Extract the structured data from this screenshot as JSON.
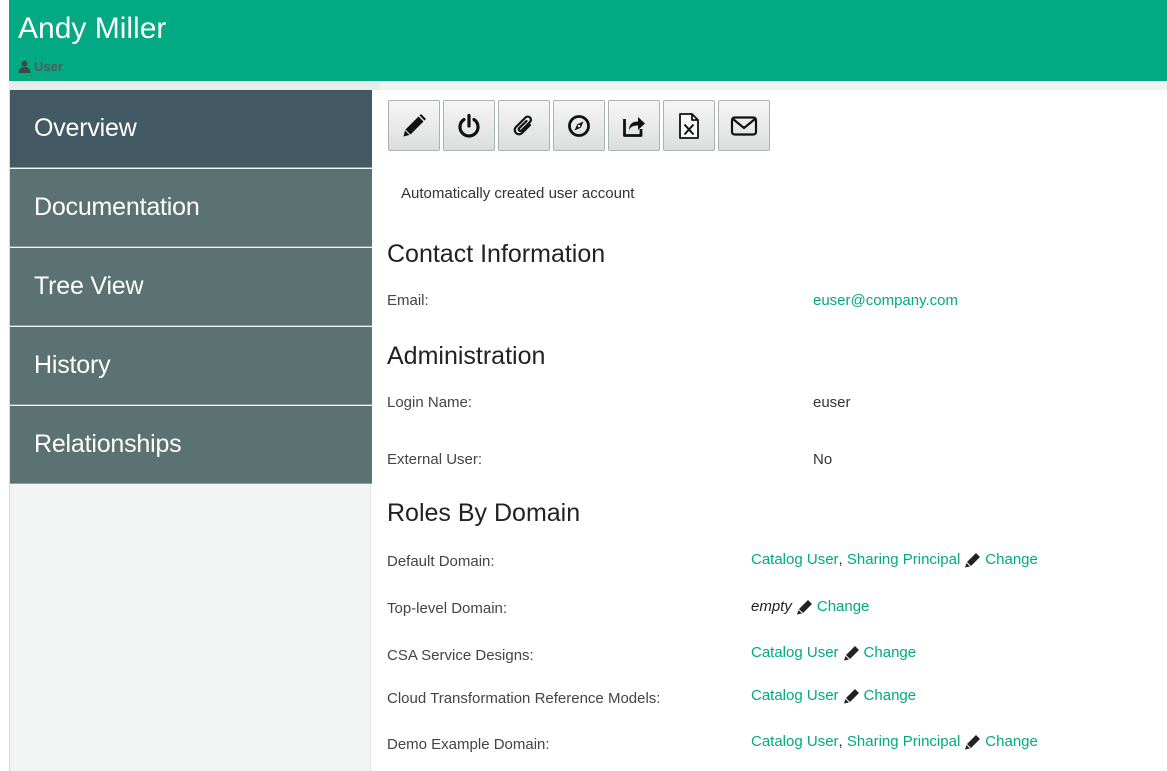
{
  "header": {
    "name": "Andy Miller",
    "role_label": "User"
  },
  "sidebar": {
    "items": [
      {
        "label": "Overview",
        "active": true
      },
      {
        "label": "Documentation",
        "active": false
      },
      {
        "label": "Tree View",
        "active": false
      },
      {
        "label": "History",
        "active": false
      },
      {
        "label": "Relationships",
        "active": false
      }
    ]
  },
  "toolbar": {
    "buttons": [
      "edit-icon",
      "power-icon",
      "attachment-icon",
      "compass-icon",
      "share-icon",
      "excel-export-icon",
      "email-icon"
    ]
  },
  "description": "Automatically created user account",
  "contact": {
    "title": "Contact Information",
    "email_label": "Email:",
    "email_value": "euser@company.com"
  },
  "administration": {
    "title": "Administration",
    "login_label": "Login Name:",
    "login_value": "euser",
    "external_label": "External User:",
    "external_value": "No"
  },
  "roles": {
    "title": "Roles By Domain",
    "change_label": "Change",
    "separator": ",",
    "rows": [
      {
        "domain": "Default Domain:",
        "roles": [
          "Catalog User",
          "Sharing Principal"
        ],
        "empty": false
      },
      {
        "domain": "Top-level Domain:",
        "roles": [],
        "empty": true,
        "empty_text": "empty"
      },
      {
        "domain": "CSA Service Designs:",
        "roles": [
          "Catalog User"
        ],
        "empty": false
      },
      {
        "domain": "Cloud Transformation Reference Models:",
        "roles": [
          "Catalog User"
        ],
        "empty": false
      },
      {
        "domain": "Demo Example Domain:",
        "roles": [
          "Catalog User",
          "Sharing Principal"
        ],
        "empty": false
      }
    ]
  },
  "colors": {
    "brand": "#02a982",
    "nav": "#5c7272",
    "nav_active": "#435964"
  }
}
